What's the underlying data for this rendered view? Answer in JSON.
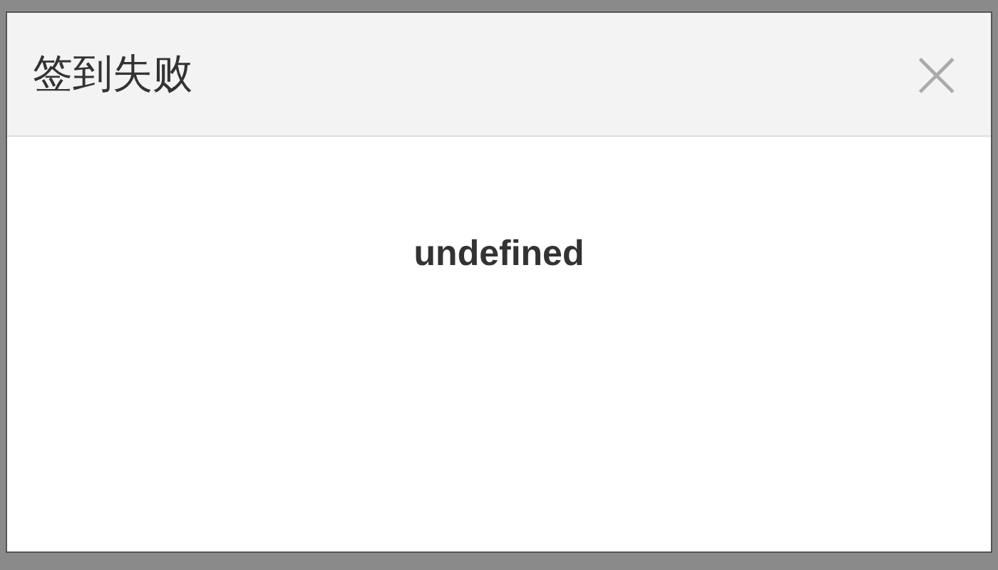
{
  "dialog": {
    "title": "签到失败",
    "close_icon": "×",
    "message": "undefined"
  }
}
